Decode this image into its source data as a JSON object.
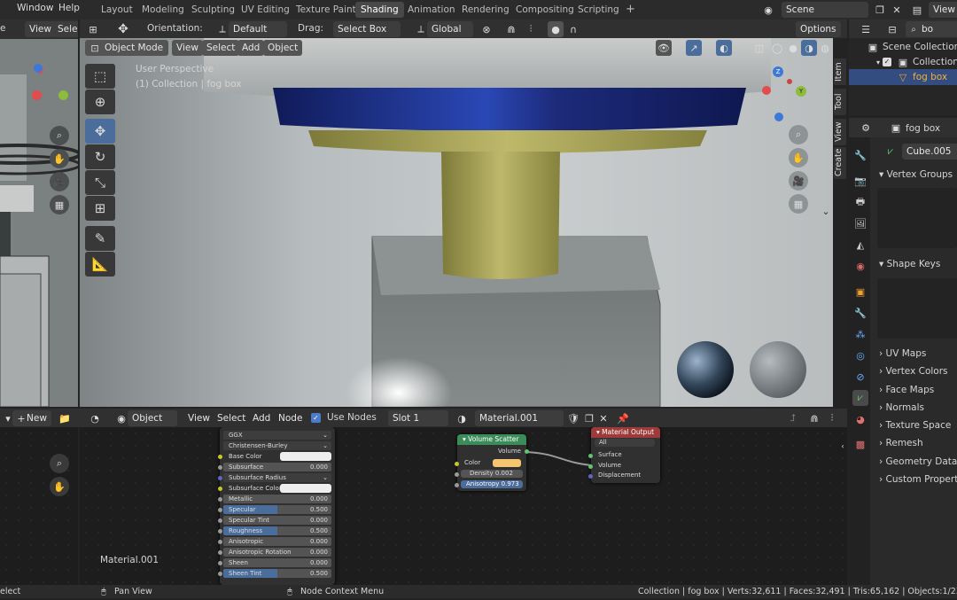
{
  "topbar": {
    "menus": [
      "Window",
      "Help"
    ],
    "workspaces": [
      "Layout",
      "Modeling",
      "Sculpting",
      "UV Editing",
      "Texture Paint",
      "Shading",
      "Animation",
      "Rendering",
      "Compositing",
      "Scripting"
    ],
    "active_workspace": "Shading",
    "add_tab": "+",
    "scene_label": "Scene",
    "view_label": "View L"
  },
  "left_editor": {
    "partial_menus": [
      "e",
      "View",
      "Selec"
    ]
  },
  "viewport_header": {
    "orientation_label": "Orientation:",
    "orientation_value": "Default",
    "drag_label": "Drag:",
    "drag_value": "Select Box",
    "transform_value": "Global",
    "options_label": "Options",
    "mode": "Object Mode",
    "menus": [
      "View",
      "Select",
      "Add",
      "Object"
    ]
  },
  "viewport": {
    "perspective": "User Perspective",
    "collection_info": "(1) Collection | fog box",
    "side_tabs": [
      "Item",
      "Tool",
      "View",
      "Create"
    ],
    "gizmo_labels": {
      "z": "Z",
      "y": "Y",
      "x": "X"
    }
  },
  "outliner": {
    "search_value": "bo",
    "items": [
      {
        "label": "Scene Collection",
        "level": 0
      },
      {
        "label": "Collection",
        "level": 1
      },
      {
        "label": "fog box",
        "level": 2
      }
    ]
  },
  "properties": {
    "object_name": "fog box",
    "mesh_name": "Cube.005",
    "panels": [
      "Vertex Groups",
      "Shape Keys",
      "UV Maps",
      "Vertex Colors",
      "Face Maps",
      "Normals",
      "Texture Space",
      "Remesh",
      "Geometry Data",
      "Custom Properties"
    ]
  },
  "node_header": {
    "object_label": "Object",
    "menus": [
      "View",
      "Select",
      "Add",
      "Node"
    ],
    "use_nodes_label": "Use Nodes",
    "slot_label": "Slot 1",
    "material_name": "Material.001",
    "new_label": "New"
  },
  "node_editor": {
    "material_label": "Material.001",
    "principled": {
      "rows": [
        {
          "label": "GGX",
          "value": "",
          "kind": "dropdown"
        },
        {
          "label": "Christensen-Burley",
          "value": "",
          "kind": "dropdown"
        },
        {
          "label": "Base Color",
          "value": "",
          "kind": "color"
        },
        {
          "label": "Subsurface",
          "value": "0.000",
          "kind": "field"
        },
        {
          "label": "Subsurface Radius",
          "value": "",
          "kind": "dropdown"
        },
        {
          "label": "Subsurface Color",
          "value": "",
          "kind": "color"
        },
        {
          "label": "Metallic",
          "value": "0.000",
          "kind": "field"
        },
        {
          "label": "Specular",
          "value": "0.500",
          "kind": "slider"
        },
        {
          "label": "Specular Tint",
          "value": "0.000",
          "kind": "field"
        },
        {
          "label": "Roughness",
          "value": "0.500",
          "kind": "slider"
        },
        {
          "label": "Anisotropic",
          "value": "0.000",
          "kind": "field"
        },
        {
          "label": "Anisotropic Rotation",
          "value": "0.000",
          "kind": "field"
        },
        {
          "label": "Sheen",
          "value": "0.000",
          "kind": "field"
        },
        {
          "label": "Sheen Tint",
          "value": "0.500",
          "kind": "slider"
        }
      ]
    },
    "volume_scatter": {
      "title": "Volume Scatter",
      "output": "Volume",
      "color_label": "Color",
      "density_label": "Density",
      "density_value": "0.002",
      "anisotropy_label": "Anisotropy",
      "anisotropy_value": "0.973"
    },
    "material_output": {
      "title": "Material Output",
      "target": "All",
      "inputs": [
        "Surface",
        "Volume",
        "Displacement"
      ]
    }
  },
  "statusbar": {
    "left": "elect",
    "pan": "Pan View",
    "context": "Node Context Menu",
    "stats": "Collection | fog box | Verts:32,611 | Faces:32,491 | Tris:65,162 | Objects:1/23 | Mem"
  },
  "colors": {
    "accent": "#4a6d9c",
    "volume_node_header": "#3c8c5a",
    "output_node_header": "#9e3a3a",
    "wood": "#a7a35a",
    "navy": "#1c2a7a"
  }
}
